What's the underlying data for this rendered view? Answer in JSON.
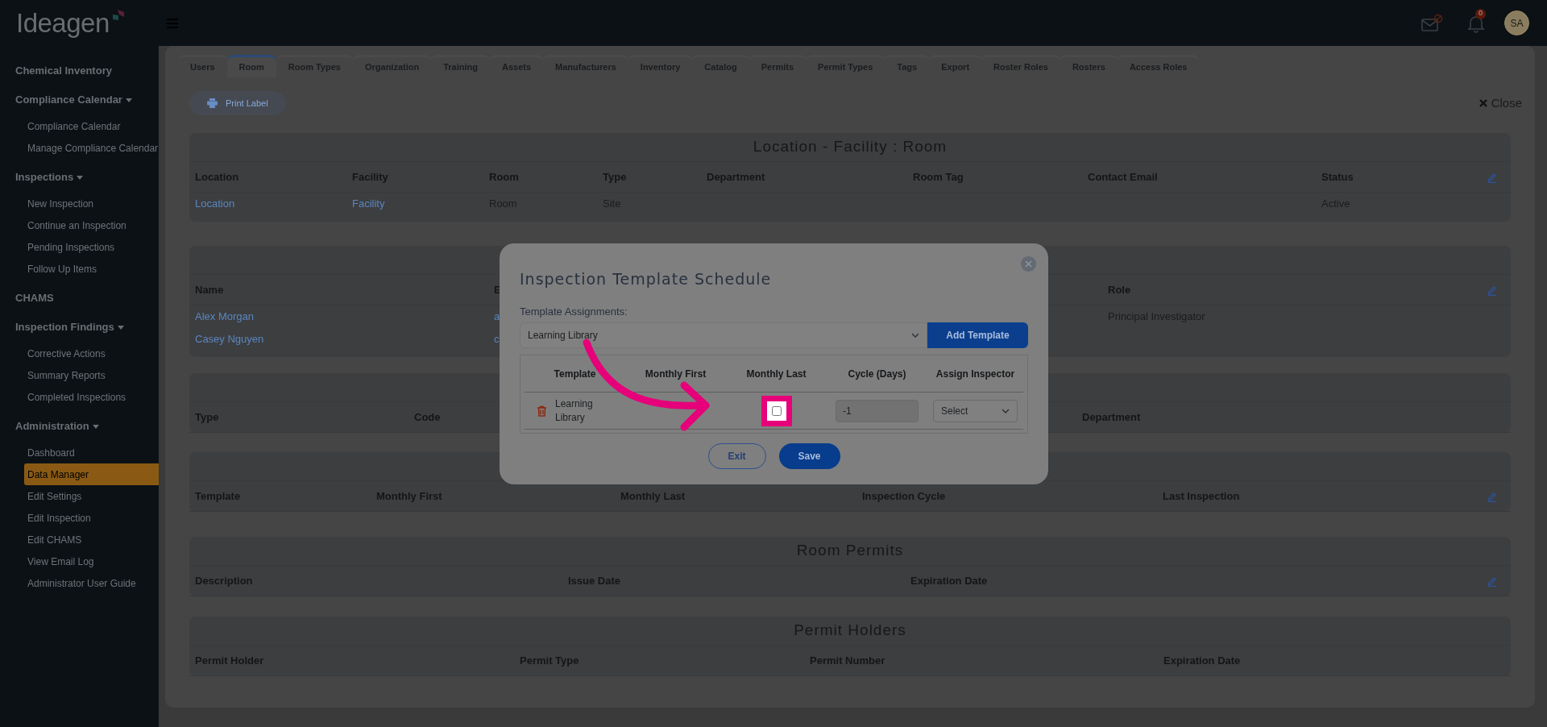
{
  "header": {
    "logo": "Ideagen",
    "notification_count": "0",
    "avatar": "SA"
  },
  "sidebar": {
    "groups": [
      {
        "label": "Chemical Inventory",
        "kind": "link"
      },
      {
        "label": "Compliance Calendar",
        "kind": "menu",
        "items": [
          {
            "label": "Compliance Calendar",
            "selected": false
          },
          {
            "label": "Manage Compliance Calendar",
            "selected": false
          }
        ]
      },
      {
        "label": "Inspections",
        "kind": "menu",
        "items": [
          {
            "label": "New Inspection",
            "selected": false
          },
          {
            "label": "Continue an Inspection",
            "selected": false
          },
          {
            "label": "Pending Inspections",
            "selected": false
          },
          {
            "label": "Follow Up Items",
            "selected": false
          }
        ]
      },
      {
        "label": "CHAMS",
        "kind": "link"
      },
      {
        "label": "Inspection Findings",
        "kind": "menu",
        "items": [
          {
            "label": "Corrective Actions",
            "selected": false
          },
          {
            "label": "Summary Reports",
            "selected": false
          },
          {
            "label": "Completed Inspections",
            "selected": false
          }
        ]
      },
      {
        "label": "Administration",
        "kind": "menu",
        "items": [
          {
            "label": "Dashboard",
            "selected": false
          },
          {
            "label": "Data Manager",
            "selected": true
          },
          {
            "label": "Edit Settings",
            "selected": false
          },
          {
            "label": "Edit Inspection",
            "selected": false
          },
          {
            "label": "Edit CHAMS",
            "selected": false
          },
          {
            "label": "View Email Log",
            "selected": false
          },
          {
            "label": "Administrator User Guide",
            "selected": false
          }
        ]
      }
    ]
  },
  "tabs": [
    {
      "label": "Users",
      "selected": false
    },
    {
      "label": "Room",
      "selected": true
    },
    {
      "label": "Room Types",
      "selected": false
    },
    {
      "label": "Organization",
      "selected": false
    },
    {
      "label": "Training",
      "selected": false
    },
    {
      "label": "Assets",
      "selected": false
    },
    {
      "label": "Manufacturers",
      "selected": false
    },
    {
      "label": "Inventory",
      "selected": false
    },
    {
      "label": "Catalog",
      "selected": false
    },
    {
      "label": "Permits",
      "selected": false
    },
    {
      "label": "Permit Types",
      "selected": false
    },
    {
      "label": "Tags",
      "selected": false
    },
    {
      "label": "Export",
      "selected": false
    },
    {
      "label": "Roster Roles",
      "selected": false
    },
    {
      "label": "Rosters",
      "selected": false
    },
    {
      "label": "Access Roles",
      "selected": false
    }
  ],
  "print_label": "Print Label",
  "close": "Close",
  "sections": [
    {
      "title": "Location - Facility : Room",
      "editable": true,
      "columns": [
        "Location",
        "Facility",
        "Room",
        "Type",
        "Department",
        "Room Tag",
        "Contact Email",
        "Status"
      ],
      "rows": [
        [
          {
            "text": "Location",
            "link": true
          },
          {
            "text": "Facility",
            "link": true
          },
          {
            "text": "Room",
            "link": false
          },
          {
            "text": "Site",
            "link": false
          },
          null,
          null,
          null,
          {
            "text": "Active",
            "link": false
          }
        ]
      ]
    },
    {
      "editable": true,
      "columns": [
        "Name",
        "E",
        "Role"
      ],
      "rows": [
        [
          {
            "text": "Alex Morgan",
            "link": true
          },
          {
            "text": "a",
            "link": true
          },
          {
            "text": "Principal Investigator",
            "link": false
          }
        ],
        [
          {
            "text": "Casey Nguyen",
            "link": true
          },
          {
            "text": "c",
            "link": true
          },
          null
        ]
      ]
    },
    {
      "editable": false,
      "columns": [
        "Type",
        "Code",
        "Department"
      ]
    },
    {
      "editable": true,
      "columns": [
        "Template",
        "Monthly First",
        "Monthly Last",
        "Inspection Cycle",
        "Last Inspection"
      ]
    },
    {
      "title": "Room Permits",
      "editable": true,
      "columns": [
        "Description",
        "Issue Date",
        "Expiration Date"
      ]
    },
    {
      "title": "Permit Holders",
      "editable": false,
      "columns": [
        "Permit Holder",
        "Permit Type",
        "Permit Number",
        "Expiration Date"
      ]
    }
  ],
  "modal": {
    "title": "Inspection Template Schedule",
    "assignments_label": "Template Assignments:",
    "assignment_value": "Learning Library",
    "add_button": "Add Template",
    "columns": [
      "Template",
      "Monthly First",
      "Monthly Last",
      "Cycle (Days)",
      "Assign Inspector"
    ],
    "rows": [
      {
        "template": "Learning Library",
        "monthly_last_checked": false,
        "cycle": "-1",
        "inspector": "Select"
      }
    ],
    "buttons": {
      "exit": "Exit",
      "save": "Save"
    }
  }
}
